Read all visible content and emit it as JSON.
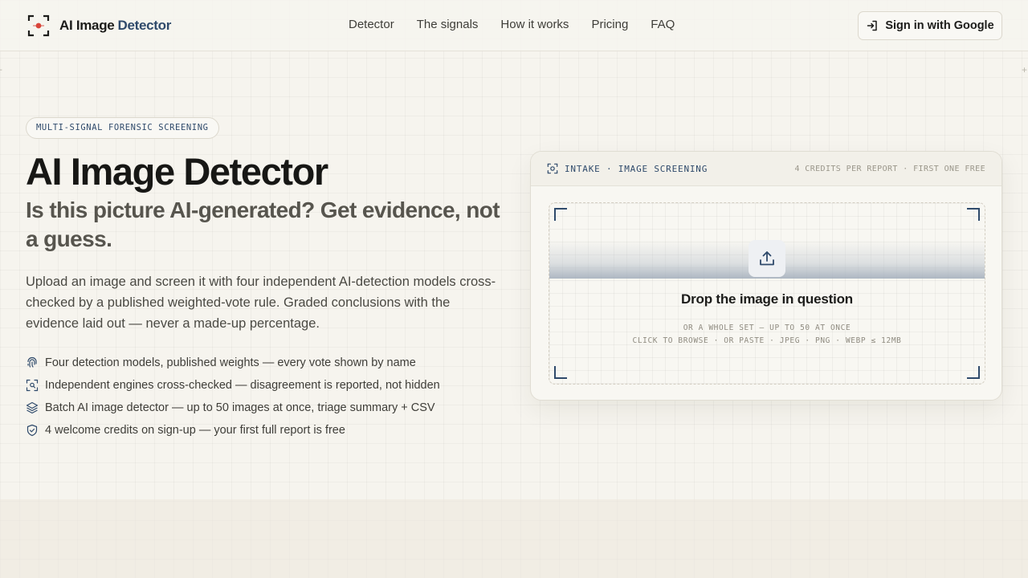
{
  "header": {
    "logo_text": "AI Image",
    "logo_accent": "Detector",
    "nav": [
      "Detector",
      "The signals",
      "How it works",
      "Pricing",
      "FAQ"
    ],
    "signin_label": "Sign in with Google"
  },
  "hero": {
    "badge": "MULTI-SIGNAL FORENSIC SCREENING",
    "title": "AI Image Detector",
    "subtitle": "Is this picture AI-generated? Get evidence, not a guess.",
    "description": "Upload an image and screen it with four independent AI-detection models cross-checked by a published weighted-vote rule. Graded conclusions with the evidence laid out — never a made-up percentage.",
    "features": [
      {
        "icon": "fingerprint-icon",
        "text": "Four detection models, published weights — every vote shown by name"
      },
      {
        "icon": "scan-face-icon",
        "text": "Independent engines cross-checked — disagreement is reported, not hidden"
      },
      {
        "icon": "layers-icon",
        "text": "Batch AI image detector — up to 50 images at once, triage summary + CSV"
      },
      {
        "icon": "shield-check-icon",
        "text": "4 welcome credits on sign-up — your first full report is free"
      }
    ]
  },
  "card": {
    "head_left": "INTAKE · IMAGE SCREENING",
    "head_right": "4 CREDITS PER REPORT · FIRST ONE FREE",
    "drop_title": "Drop the image in question",
    "drop_line1": "OR A WHOLE SET — UP TO 50 AT ONCE",
    "drop_line2": "CLICK TO BROWSE · OR PASTE · JPEG · PNG · WEBP ≤ 12MB"
  },
  "colors": {
    "accent": "#2f4a6b",
    "logo_dot": "#d9453a",
    "background": "#f6f4ee"
  }
}
